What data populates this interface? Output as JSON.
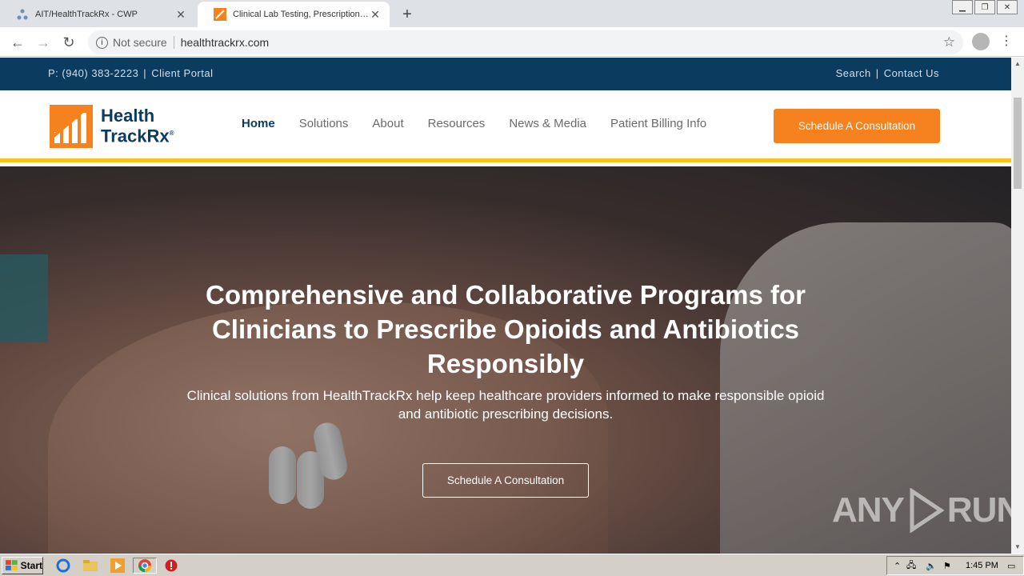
{
  "browser": {
    "tabs": [
      {
        "title": "AIT/HealthTrackRx - CWP",
        "active": false
      },
      {
        "title": "Clinical Lab Testing, Prescription Dru",
        "active": true
      }
    ],
    "new_tab_label": "+",
    "security_label": "Not secure",
    "url": "healthtrackrx.com"
  },
  "site": {
    "topbar": {
      "phone": "P: (940) 383-2223",
      "separator": "|",
      "client_portal": "Client Portal",
      "search": "Search",
      "contact": "Contact Us"
    },
    "logo": {
      "line1": "Health",
      "line2": "TrackRx",
      "reg": "®"
    },
    "nav": [
      "Home",
      "Solutions",
      "About",
      "Resources",
      "News & Media",
      "Patient Billing Info"
    ],
    "cta_label": "Schedule A Consultation",
    "hero": {
      "headline": "Comprehensive and Collaborative Programs for Clinicians to Prescribe Opioids and Antibiotics Responsibly",
      "subtext": "Clinical solutions from HealthTrackRx help keep healthcare providers informed to make responsible opioid and antibiotic prescribing decisions.",
      "button_label": "Schedule A Consultation"
    },
    "watermark": {
      "left": "ANY",
      "right": "RUN"
    }
  },
  "taskbar": {
    "start_label": "Start",
    "clock": "1:45 PM"
  },
  "colors": {
    "brand_navy": "#0b3b5e",
    "brand_orange": "#f5821f",
    "accent_yellow": "#f6c515"
  }
}
